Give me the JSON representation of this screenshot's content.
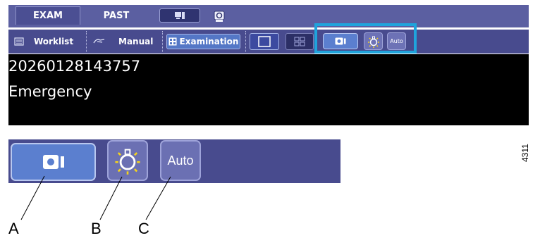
{
  "tabs": {
    "exam": "EXAM",
    "past": "PAST"
  },
  "toolbar": {
    "worklist": "Worklist",
    "manual": "Manual",
    "examination": "Examination",
    "auto": "Auto"
  },
  "info": {
    "id": "20260128143757",
    "patient_type": "Emergency"
  },
  "detail": {
    "auto": "Auto"
  },
  "callouts": {
    "a": "A",
    "b": "B",
    "c": "C"
  },
  "figure_number": "4311",
  "colors": {
    "highlight": "#1fa4dc",
    "bar": "#484b8e",
    "button_blue": "#5b7fcf",
    "bulb_yellow": "#f4d21c"
  },
  "icons": [
    "list-icon",
    "hand-icon",
    "examination-icon",
    "single-view-icon",
    "quad-view-icon",
    "video-camera-icon",
    "light-bulb-icon",
    "monitor-icon",
    "media-icon"
  ]
}
